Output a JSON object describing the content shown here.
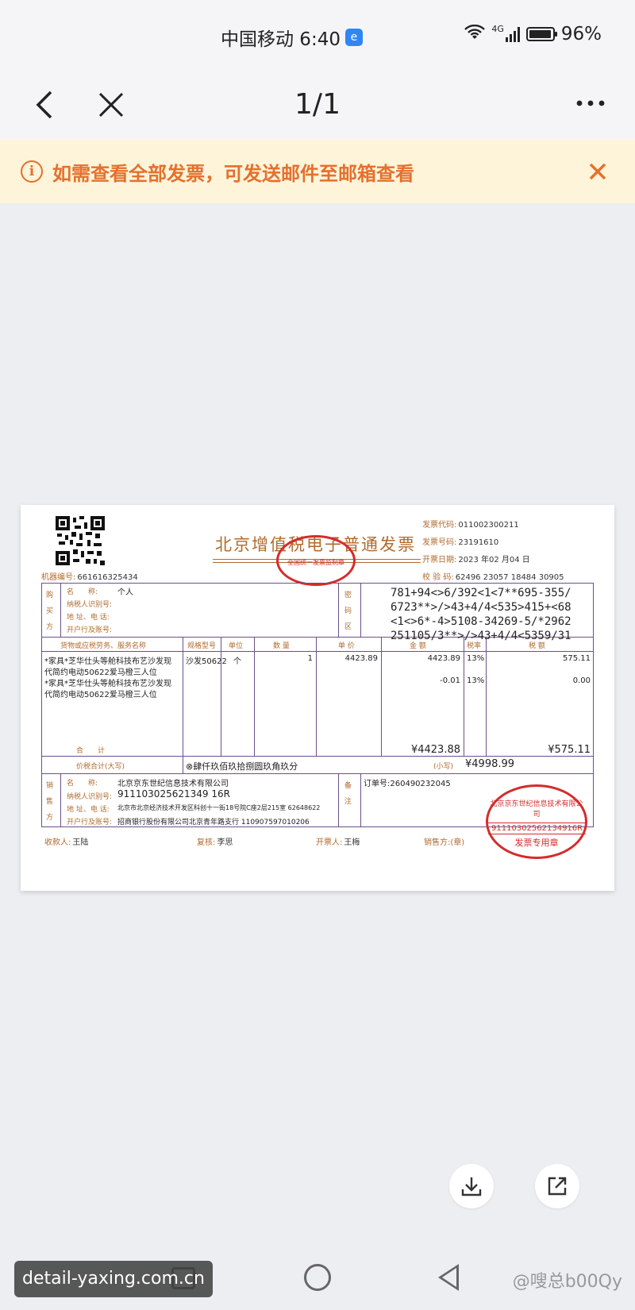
{
  "status_bar": {
    "carrier_time": "中国移动 6:40",
    "network": "4G",
    "battery": "96%",
    "battery_level": 0.96
  },
  "nav": {
    "page_indicator": "1/1"
  },
  "notice": {
    "text": "如需查看全部发票，可发送邮件至邮箱查看"
  },
  "invoice": {
    "title": "北京增值税电子普通发票",
    "stamp_top": "全国统一发票监制章",
    "machine_no_label": "机器编号:",
    "machine_no": "661616325434",
    "code_label": "发票代码:",
    "code": "011002300211",
    "number_label": "发票号码:",
    "number": "23191610",
    "date_label": "开票日期:",
    "date": "2023 年02 月04 日",
    "check_label": "校 验 码:",
    "check": "62496 23057 18484 30905",
    "buyer": {
      "side": "购买方",
      "name_label": "名　　称:",
      "name": "个人",
      "tax_label": "纳税人识别号:",
      "addr_label": "地 址、电 话:",
      "bank_label": "开户行及账号:"
    },
    "password_side": "密码区",
    "password_lines": [
      "781+94<>6/392<1<7**695-355/",
      "6723**>/>43+4/4<535>415+<68",
      "<1<>6*-4>5108-34269-5/*2962",
      "251105/3**>/>43+4/4<5359/31"
    ],
    "headers": [
      "货物或应税劳务、服务名称",
      "规格型号",
      "单位",
      "数 量",
      "单 价",
      "金 额",
      "税率",
      "税 额"
    ],
    "items": [
      {
        "name1": "*家具*芝华仕头等舱科技布艺沙发现",
        "name2": "代简约电动50622爱马橙三人位",
        "spec": "沙发50622",
        "unit": "个",
        "qty": "1",
        "price": "4423.89",
        "amount": "4423.89",
        "rate": "13%",
        "tax": "575.11"
      },
      {
        "name1": "*家具*芝华仕头等舱科技布艺沙发现",
        "name2": "代简约电动50622爱马橙三人位",
        "spec": "",
        "unit": "",
        "qty": "",
        "price": "",
        "amount": "-0.01",
        "rate": "13%",
        "tax": "0.00"
      }
    ],
    "total_label": "合　　计",
    "total_amount": "¥4423.88",
    "total_tax": "¥575.11",
    "grand_label": "价税合计(大写)",
    "grand_words": "⊗肆仟玖佰玖拾捌圆玖角玖分",
    "grand_small_label": "(小写)",
    "grand_small": "¥4998.99",
    "seller": {
      "side": "销售方",
      "name_label": "名　　称:",
      "name": "北京京东世纪信息技术有限公司",
      "tax_label": "纳税人识别号:",
      "tax_id": "911103025621349 16R",
      "addr_label": "地 址、电 话:",
      "addr": "北京市北京经济技术开发区科创十一街18号院C座2层215室 62648622",
      "bank_label": "开户行及账号:",
      "bank": "招商银行股份有限公司北京青年路支行 110907597010206"
    },
    "remark_side": "备注",
    "order_no": "订单号:260490232045",
    "stamp_seller_name": "北京京东世纪信息技术有限公司",
    "stamp_seller_id": "91110302562134916R",
    "stamp_seller_text": "发票专用章",
    "payee_label": "收款人:",
    "payee": "王陆",
    "reviewer_label": "复核:",
    "reviewer": "李思",
    "issuer_label": "开票人:",
    "issuer": "王梅",
    "seller_seal_label": "销售方:(章)"
  },
  "watermarks": {
    "left": "detail-yaxing.com.cn",
    "right": "@嗖总b00Qy"
  }
}
